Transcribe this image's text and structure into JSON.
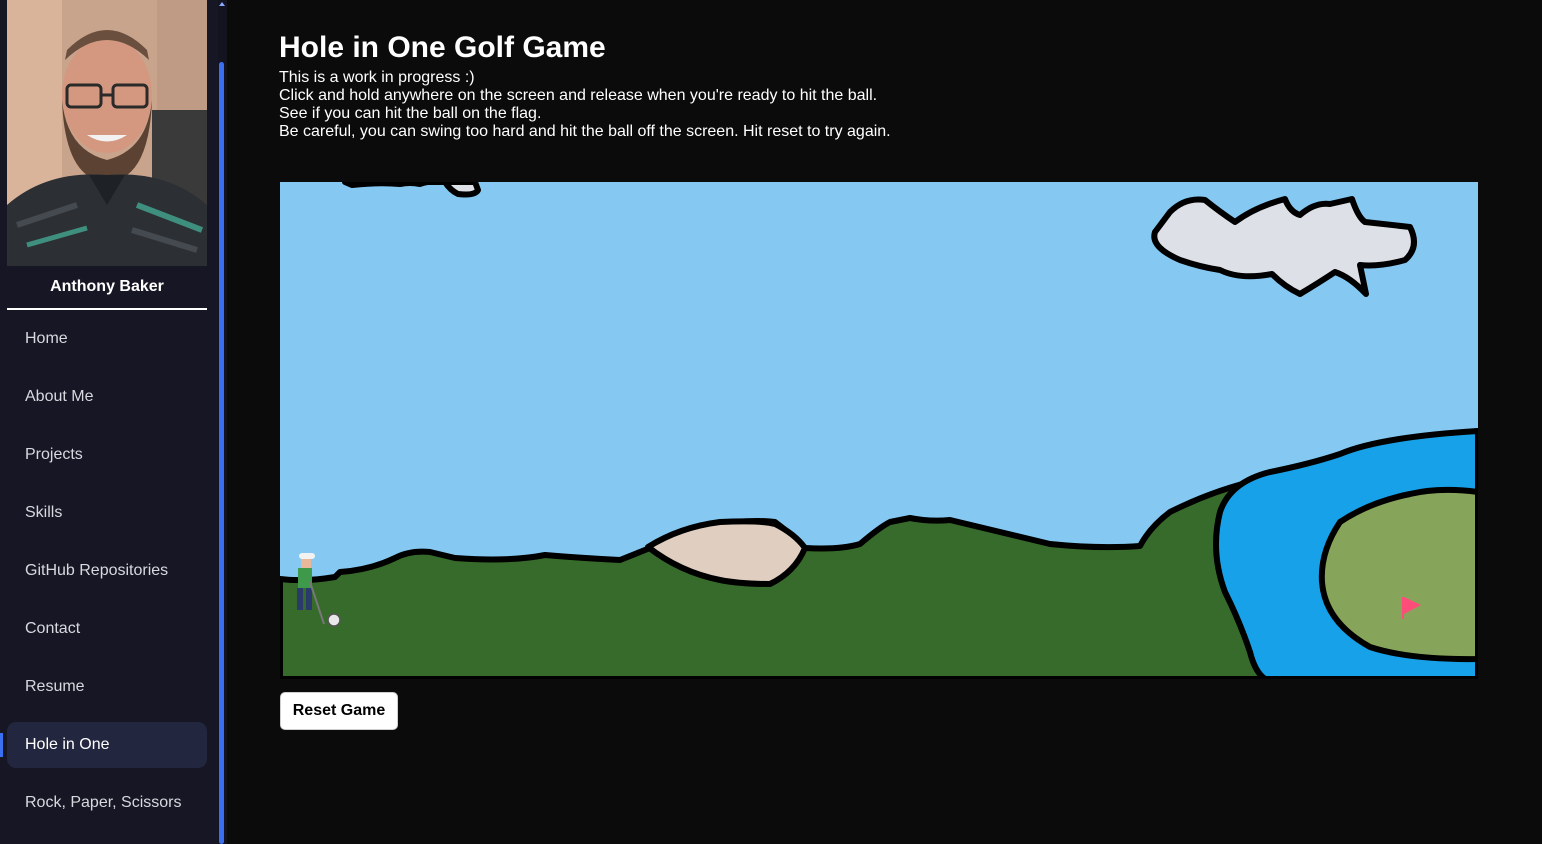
{
  "sidebar": {
    "profile_name": "Anthony Baker",
    "items": [
      {
        "label": "Home"
      },
      {
        "label": "About Me"
      },
      {
        "label": "Projects"
      },
      {
        "label": "Skills"
      },
      {
        "label": "GitHub Repositories"
      },
      {
        "label": "Contact"
      },
      {
        "label": "Resume"
      },
      {
        "label": "Hole in One"
      },
      {
        "label": "Rock, Paper, Scissors"
      }
    ],
    "active_item": "Hole in One",
    "accent_color": "#3a6ff0"
  },
  "main": {
    "title": "Hole in One Golf Game",
    "description": [
      "This is a work in progress :)",
      "Click and hold anywhere on the screen and release when you're ready to hit the ball.",
      "See if you can hit the ball on the flag.",
      "Be careful, you can swing too hard and hit the ball off the screen. Hit reset to try again."
    ],
    "reset_label": "Reset Game"
  },
  "game": {
    "sky_color": "#85c9f2",
    "grass_color": "#376b2b",
    "water_color": "#17a1e8",
    "green_color": "#87a55a",
    "sand_color": "#e0cfc0",
    "cloud_color": "#dde0e6",
    "flag_color": "#ff4d7a",
    "icons": [
      "golfer-icon",
      "golf-ball-icon",
      "flag-icon",
      "cloud-icon"
    ]
  }
}
